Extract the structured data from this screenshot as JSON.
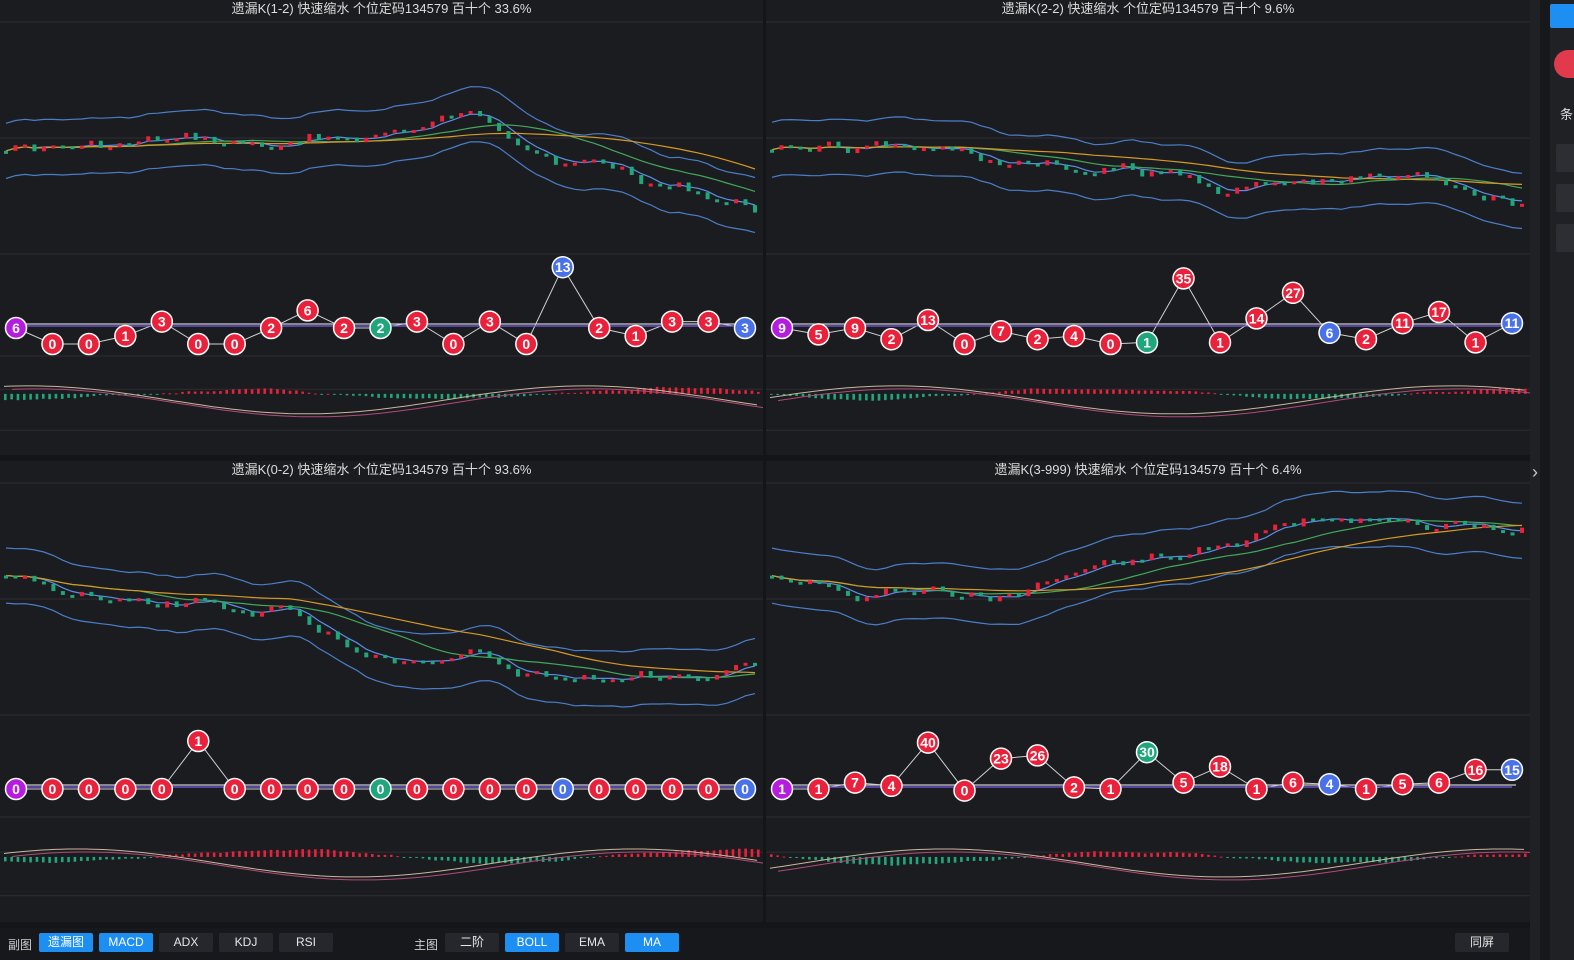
{
  "colors": {
    "red": "#e9213a",
    "green": "#1fa67a",
    "blue": "#4a72e8",
    "purple": "#b51ce0",
    "ma_yellow": "#d69a24",
    "ma_green": "#42a85a",
    "band": "#4a7ec9",
    "accent": "#1e8ff2"
  },
  "charts": [
    {
      "id": "tl",
      "title": "遗漏K(1-2)  快速缩水  个位定码134579  百十个  33.6%",
      "balls": [
        {
          "v": "6",
          "c": "purple",
          "lv": 0
        },
        {
          "v": "0",
          "c": "red",
          "lv": -1
        },
        {
          "v": "0",
          "c": "red",
          "lv": -1
        },
        {
          "v": "1",
          "c": "red",
          "lv": -0.5
        },
        {
          "v": "3",
          "c": "red",
          "lv": 0.4
        },
        {
          "v": "0",
          "c": "red",
          "lv": -1
        },
        {
          "v": "0",
          "c": "red",
          "lv": -1
        },
        {
          "v": "2",
          "c": "red",
          "lv": 0
        },
        {
          "v": "6",
          "c": "red",
          "lv": 1.1
        },
        {
          "v": "2",
          "c": "red",
          "lv": 0
        },
        {
          "v": "2",
          "c": "green",
          "lv": 0
        },
        {
          "v": "3",
          "c": "red",
          "lv": 0.4
        },
        {
          "v": "0",
          "c": "red",
          "lv": -1
        },
        {
          "v": "3",
          "c": "red",
          "lv": 0.4
        },
        {
          "v": "0",
          "c": "red",
          "lv": -1
        },
        {
          "v": "13",
          "c": "blue",
          "lv": 3.8
        },
        {
          "v": "2",
          "c": "red",
          "lv": 0
        },
        {
          "v": "1",
          "c": "red",
          "lv": -0.5
        },
        {
          "v": "3",
          "c": "red",
          "lv": 0.4
        },
        {
          "v": "3",
          "c": "red",
          "lv": 0.4
        },
        {
          "v": "3",
          "c": "blue",
          "lv": 0
        }
      ]
    },
    {
      "id": "tr",
      "title": "遗漏K(2-2)  快速缩水  个位定码134579  百十个  9.6%",
      "balls": [
        {
          "v": "9",
          "c": "purple",
          "lv": 0
        },
        {
          "v": "5",
          "c": "red",
          "lv": -0.4
        },
        {
          "v": "9",
          "c": "red",
          "lv": 0
        },
        {
          "v": "2",
          "c": "red",
          "lv": -0.7
        },
        {
          "v": "13",
          "c": "red",
          "lv": 0.5
        },
        {
          "v": "0",
          "c": "red",
          "lv": -1
        },
        {
          "v": "7",
          "c": "red",
          "lv": -0.2
        },
        {
          "v": "2",
          "c": "red",
          "lv": -0.7
        },
        {
          "v": "4",
          "c": "red",
          "lv": -0.5
        },
        {
          "v": "0",
          "c": "red",
          "lv": -1
        },
        {
          "v": "1",
          "c": "green",
          "lv": -0.9
        },
        {
          "v": "35",
          "c": "red",
          "lv": 3.1
        },
        {
          "v": "1",
          "c": "red",
          "lv": -0.9
        },
        {
          "v": "14",
          "c": "red",
          "lv": 0.6
        },
        {
          "v": "27",
          "c": "red",
          "lv": 2.2
        },
        {
          "v": "6",
          "c": "blue",
          "lv": -0.3
        },
        {
          "v": "2",
          "c": "red",
          "lv": -0.7
        },
        {
          "v": "11",
          "c": "red",
          "lv": 0.3
        },
        {
          "v": "17",
          "c": "red",
          "lv": 1.0
        },
        {
          "v": "1",
          "c": "red",
          "lv": -0.9
        },
        {
          "v": "11",
          "c": "blue",
          "lv": 0.3
        }
      ]
    },
    {
      "id": "bl",
      "title": "遗漏K(0-2)  快速缩水  个位定码134579  百十个  93.6%",
      "balls": [
        {
          "v": "0",
          "c": "purple",
          "lv": 0
        },
        {
          "v": "0",
          "c": "red",
          "lv": 0
        },
        {
          "v": "0",
          "c": "red",
          "lv": 0
        },
        {
          "v": "0",
          "c": "red",
          "lv": 0
        },
        {
          "v": "0",
          "c": "red",
          "lv": 0
        },
        {
          "v": "1",
          "c": "red",
          "lv": 3.0
        },
        {
          "v": "0",
          "c": "red",
          "lv": 0
        },
        {
          "v": "0",
          "c": "red",
          "lv": 0
        },
        {
          "v": "0",
          "c": "red",
          "lv": 0
        },
        {
          "v": "0",
          "c": "red",
          "lv": 0
        },
        {
          "v": "0",
          "c": "green",
          "lv": 0
        },
        {
          "v": "0",
          "c": "red",
          "lv": 0
        },
        {
          "v": "0",
          "c": "red",
          "lv": 0
        },
        {
          "v": "0",
          "c": "red",
          "lv": 0
        },
        {
          "v": "0",
          "c": "red",
          "lv": 0
        },
        {
          "v": "0",
          "c": "blue",
          "lv": 0
        },
        {
          "v": "0",
          "c": "red",
          "lv": 0
        },
        {
          "v": "0",
          "c": "red",
          "lv": 0
        },
        {
          "v": "0",
          "c": "red",
          "lv": 0
        },
        {
          "v": "0",
          "c": "red",
          "lv": 0
        },
        {
          "v": "0",
          "c": "blue",
          "lv": 0
        }
      ]
    },
    {
      "id": "br",
      "title": "遗漏K(3-999)  快速缩水  个位定码134579  百十个  6.4%",
      "balls": [
        {
          "v": "1",
          "c": "purple",
          "lv": 0
        },
        {
          "v": "1",
          "c": "red",
          "lv": 0
        },
        {
          "v": "7",
          "c": "red",
          "lv": 0.4
        },
        {
          "v": "4",
          "c": "red",
          "lv": 0.2
        },
        {
          "v": "40",
          "c": "red",
          "lv": 2.9
        },
        {
          "v": "0",
          "c": "red",
          "lv": -0.1
        },
        {
          "v": "23",
          "c": "red",
          "lv": 1.9
        },
        {
          "v": "26",
          "c": "red",
          "lv": 2.1
        },
        {
          "v": "2",
          "c": "red",
          "lv": 0.1
        },
        {
          "v": "1",
          "c": "red",
          "lv": 0
        },
        {
          "v": "30",
          "c": "green",
          "lv": 2.3
        },
        {
          "v": "5",
          "c": "red",
          "lv": 0.4
        },
        {
          "v": "18",
          "c": "red",
          "lv": 1.4
        },
        {
          "v": "1",
          "c": "red",
          "lv": 0
        },
        {
          "v": "6",
          "c": "red",
          "lv": 0.4
        },
        {
          "v": "4",
          "c": "blue",
          "lv": 0.3
        },
        {
          "v": "1",
          "c": "red",
          "lv": 0
        },
        {
          "v": "5",
          "c": "red",
          "lv": 0.3
        },
        {
          "v": "6",
          "c": "red",
          "lv": 0.4
        },
        {
          "v": "16",
          "c": "red",
          "lv": 1.2
        },
        {
          "v": "15",
          "c": "blue",
          "lv": 1.2
        }
      ]
    }
  ],
  "toolbar": {
    "sub_label": "副图",
    "sub_buttons": [
      {
        "label": "遗漏图",
        "active": true
      },
      {
        "label": "MACD",
        "active": true
      },
      {
        "label": "ADX",
        "active": false
      },
      {
        "label": "KDJ",
        "active": false
      },
      {
        "label": "RSI",
        "active": false
      }
    ],
    "main_label": "主图",
    "main_buttons": [
      {
        "label": "二阶",
        "active": false
      },
      {
        "label": "BOLL",
        "active": true
      },
      {
        "label": "EMA",
        "active": false
      },
      {
        "label": "MA",
        "active": true
      }
    ],
    "sync_label": "同屏"
  },
  "rightbar": {
    "glyph": "条"
  }
}
